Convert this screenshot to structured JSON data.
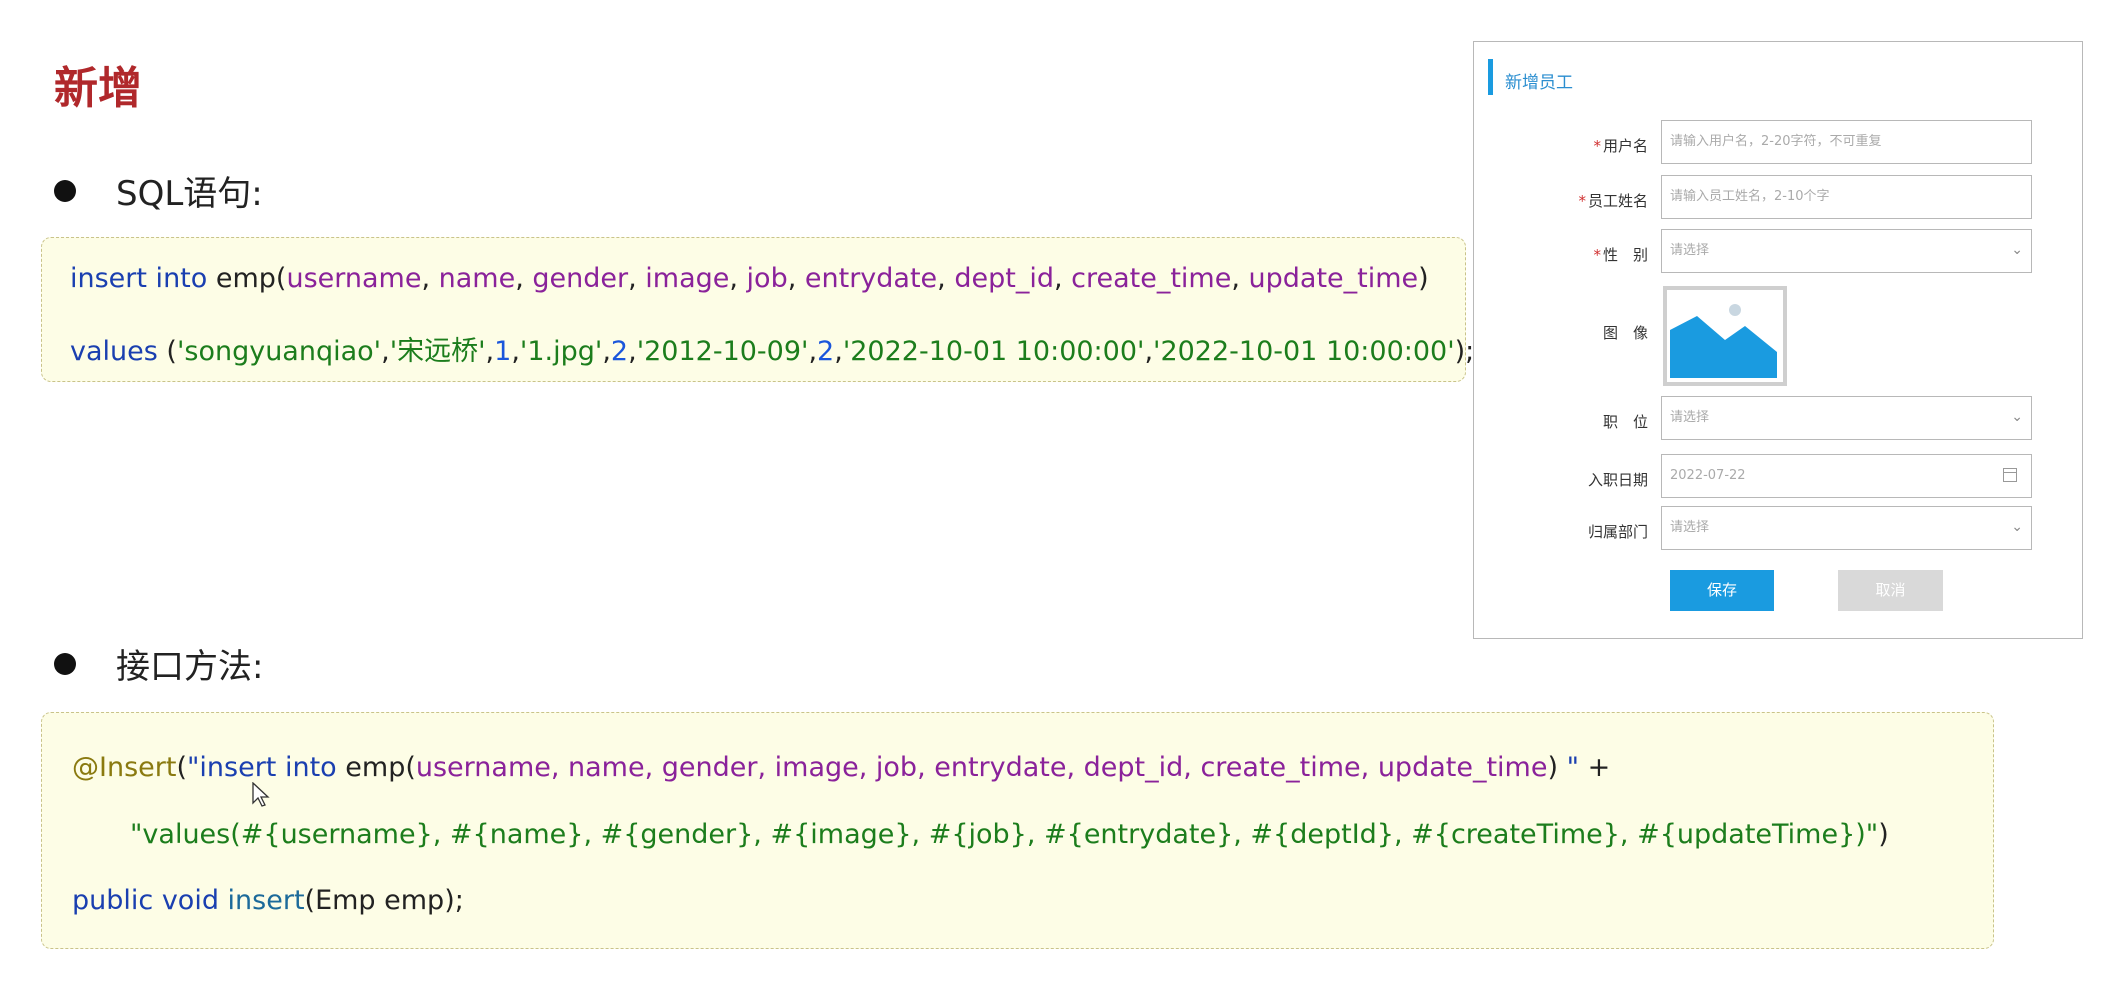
{
  "title": "新增",
  "sections": {
    "sql_label": "SQL语句:",
    "api_label": "接口方法:"
  },
  "sql_code": {
    "l1": {
      "t1": "insert into",
      "t2": " emp(",
      "t3": "username",
      "t4": ", ",
      "t5": "name",
      "t6": ", ",
      "t7": "gender",
      "t8": ", ",
      "t9": "image",
      "t10": ", ",
      "t11": "job",
      "t12": ", ",
      "t13": "entrydate",
      "t14": ", ",
      "t15": "dept_id",
      "t16": ", ",
      "t17": "create_time",
      "t18": ", ",
      "t19": "update_time",
      "t20": ")"
    },
    "l2": {
      "t1": "values",
      "t2": " (",
      "t3": "'songyuanqiao'",
      "t4": ",",
      "t5": "'宋远桥'",
      "t6": ",",
      "t7": "1",
      "t8": ",",
      "t9": "'1.jpg'",
      "t10": ",",
      "t11": "2",
      "t12": ",",
      "t13": "'2012-10-09'",
      "t14": ",",
      "t15": "2",
      "t16": ",",
      "t17": "'2022-10-01 10:00:00'",
      "t18": ",",
      "t19": "'2022-10-01 10:00:00'",
      "t20": ");"
    }
  },
  "api_code": {
    "l1": {
      "t1": "@Insert",
      "t2": "(",
      "t3": "\"insert into",
      "t4": " emp(",
      "t5": "username, name, gender, image, job, entrydate, dept_id, create_time, update_time",
      "t6": ") ",
      "t7": "\"",
      "t8": " +"
    },
    "l2": {
      "t1": "\"values(#{username}, #{name}, #{gender}, #{image}, #{job}, #{entrydate}, #{deptId}, #{createTime}, #{updateTime})\"",
      "t2": ")"
    },
    "l3": {
      "t1": "public void",
      "t2": " insert",
      "t3": "(Emp emp);"
    }
  },
  "form": {
    "title": "新增员工",
    "username_label": "用户名",
    "username_placeholder": "请输入用户名，2-20字符，不可重复",
    "name_label": "员工姓名",
    "name_placeholder": "请输入员工姓名，2-10个字",
    "gender_label": "性　别",
    "gender_value": "请选择",
    "image_label": "图　像",
    "job_label": "职　位",
    "job_value": "请选择",
    "entrydate_label": "入职日期",
    "entrydate_value": "2022-07-22",
    "dept_label": "归属部门",
    "dept_value": "请选择",
    "save_label": "保存",
    "cancel_label": "取消",
    "image_icon": "image-placeholder-icon",
    "date_icon": "calendar-icon",
    "select_icon": "chevron-down-icon"
  },
  "colors": {
    "title": "#b0282b",
    "keyword": "#1a3fb0",
    "field": "#8a229a",
    "string": "#1c7d1c",
    "accent": "#1a9be0"
  }
}
